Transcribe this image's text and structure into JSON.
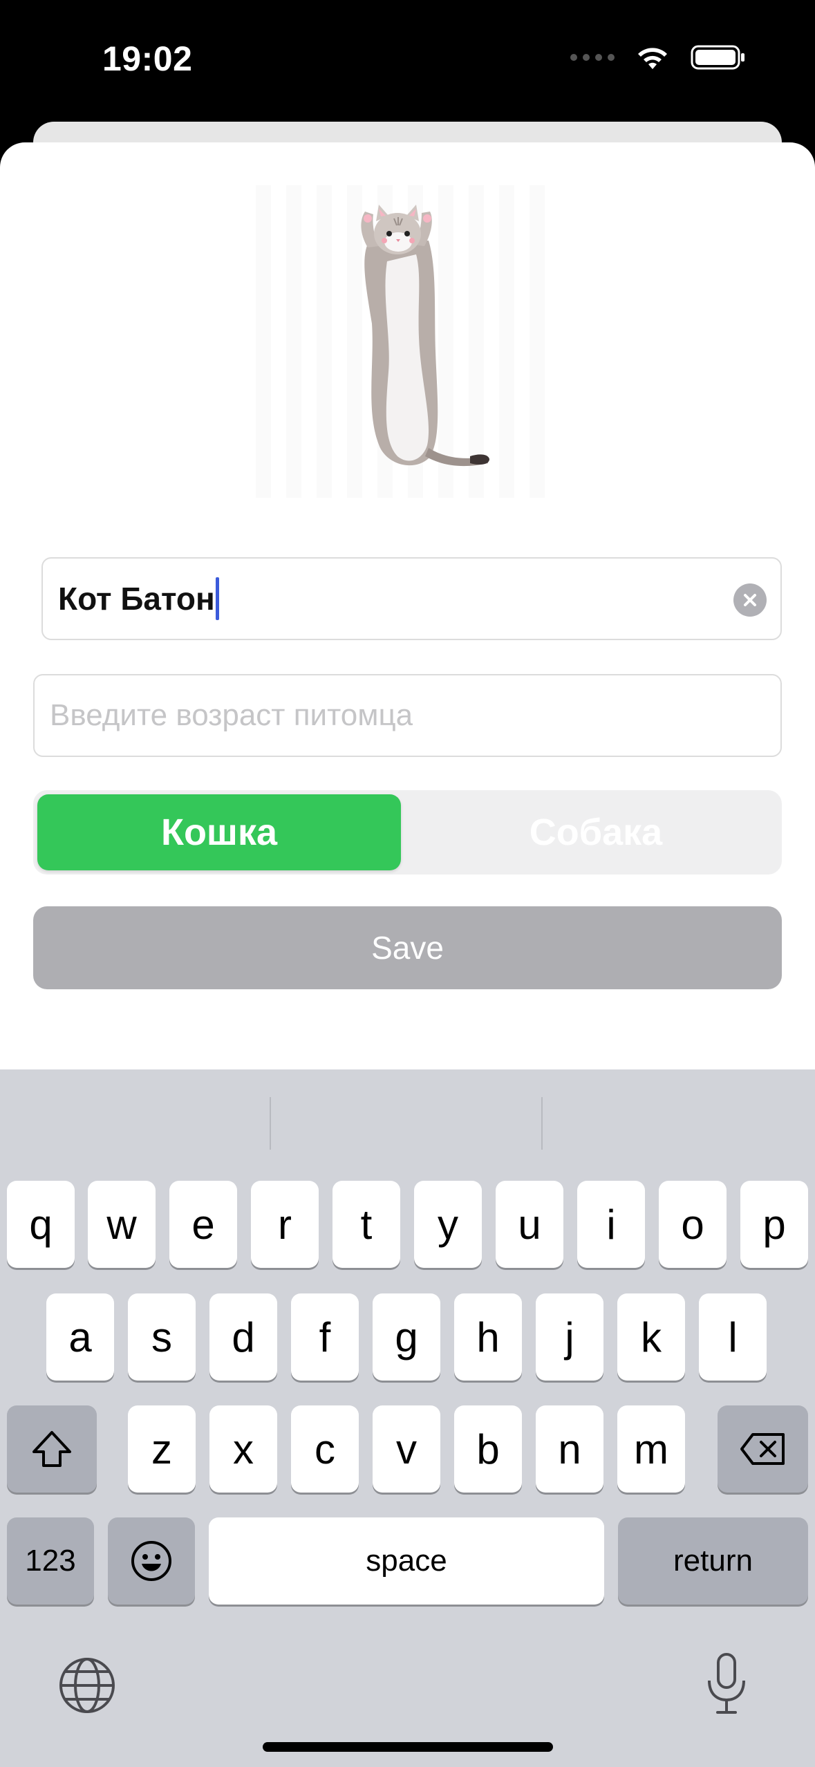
{
  "status_bar": {
    "time": "19:02"
  },
  "form": {
    "name_value": "Кот Батон",
    "age_placeholder": "Введите возраст питомца",
    "pet_type_options": [
      "Кошка",
      "Собака"
    ],
    "pet_type_selected": "Кошка",
    "save_label": "Save"
  },
  "keyboard": {
    "row1": [
      "q",
      "w",
      "e",
      "r",
      "t",
      "y",
      "u",
      "i",
      "o",
      "p"
    ],
    "row2": [
      "a",
      "s",
      "d",
      "f",
      "g",
      "h",
      "j",
      "k",
      "l"
    ],
    "row3": [
      "z",
      "x",
      "c",
      "v",
      "b",
      "n",
      "m"
    ],
    "numbers_label": "123",
    "space_label": "space",
    "return_label": "return"
  },
  "colors": {
    "accent_green": "#34c759",
    "save_disabled": "#aeaeb2",
    "caret": "#3b5bdb"
  }
}
